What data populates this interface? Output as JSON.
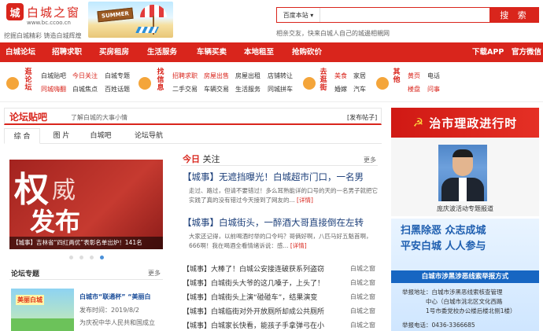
{
  "header": {
    "logo_mark": "城",
    "logo_name": "白城之窗",
    "logo_url": "www.bc.ccoo.cn",
    "slogan": "挖掘白城精彩 铸造白城辉煌",
    "banner_text": "SUMMER"
  },
  "search": {
    "select_label": "百度本站 ▾",
    "placeholder": "",
    "button_label": "搜 索",
    "hint": "相亲交友，快来白城人自己的城邊相親网"
  },
  "nav": {
    "items": [
      "白城论坛",
      "招聘求职",
      "买房租房",
      "生活服务",
      "车辆买卖",
      "本地租至",
      "抢购砍价"
    ],
    "right": [
      "下载APP",
      "官方微信"
    ]
  },
  "categories": [
    {
      "title": "逛论坛",
      "links": [
        "白城贴吧",
        "今日关注",
        "白城专题",
        "同城嗨翻",
        "白城焦点",
        "百姓话题"
      ]
    },
    {
      "title": "找信息",
      "links": [
        "招聘求职",
        "房屋出售",
        "房屋出租",
        "店铺转让",
        "二手交易",
        "车辆交易",
        "生活服务",
        "同城拼车"
      ]
    },
    {
      "title": "去逛街",
      "links": [
        "美食",
        "家居",
        "婚嫁",
        "汽车"
      ]
    },
    {
      "title": "其他",
      "links": [
        "黄页",
        "电话",
        "楼盘",
        "问事"
      ]
    }
  ],
  "forum": {
    "title": "论坛贴吧",
    "subtitle": "了解白城的大事小情",
    "post_button": "[发布帖子]",
    "tabs": [
      "综 合",
      "图 片",
      "白城吧",
      "论坛导航"
    ]
  },
  "slide": {
    "text1": "权",
    "text2": "威",
    "text3": "发布",
    "caption": "【城事】吉林省“四红两优”表彰名单出炉！141名"
  },
  "topics": {
    "title": "论坛专题",
    "more": "更多",
    "image_text": "美丽白城",
    "name": "白城市“联通杯” “美丽白",
    "date": "发布时间：2019/8/2",
    "desc": "为庆祝中华人民共和国成立"
  },
  "news": {
    "head_red": "今日",
    "head_rest": " 关注",
    "more": "更多",
    "headlines": [
      {
        "title": "【城事】无遮挡曝光！白城超市门口，一名男",
        "body": "走过、路过，但请不要错过！多么耳熟能详的口号的天的一名男子就把它实践了真的没有错过今天接到了网友的...",
        "more": "[详情]"
      },
      {
        "title": "【城事】白城街头，一醉酒大哥直接倒在左转",
        "body": "大家还记得，以前喝酒时举的口令吗？哥俩好啊，八匹马好五魁首啊，666啊！我在喝酒全看情绪诉说：感...",
        "more": "[详情]"
      }
    ],
    "items": [
      {
        "title": "【城事】大棒了！白城公安接连破获系列盗窃",
        "src": "白城之窗"
      },
      {
        "title": "【城事】白城街头大爷的这几嗓子，上头了！",
        "src": "白城之窗"
      },
      {
        "title": "【城事】白城街头上演“碰碰车”，结果演变",
        "src": "白城之窗"
      },
      {
        "title": "【城事】白城临街对外开放厕所却成公共厕所",
        "src": "白城之窗"
      },
      {
        "title": "【城事】白城家长快看，能孩子手拿弹弓在小",
        "src": "白城之窗"
      }
    ]
  },
  "right": {
    "banner1": "治市理政进行时",
    "portrait_caption": "庞庆波活动专题报道",
    "banner2_line1": "扫黑除恶 众志成城",
    "banner2_line2": "平安白城 人人参与",
    "banner2_bar": "白城市涉黑涉恶线索举报方式",
    "info": [
      "举报地址：白城市涉黑恶线索核查管理",
      "中心（白城市洮北区文化西路",
      "1号市委党校办公楼后楼北侧1楼）",
      "举报电话：0436-3366685"
    ]
  },
  "colors": {
    "brand_red": "#d9251c",
    "link_blue": "#1c3f7a"
  }
}
